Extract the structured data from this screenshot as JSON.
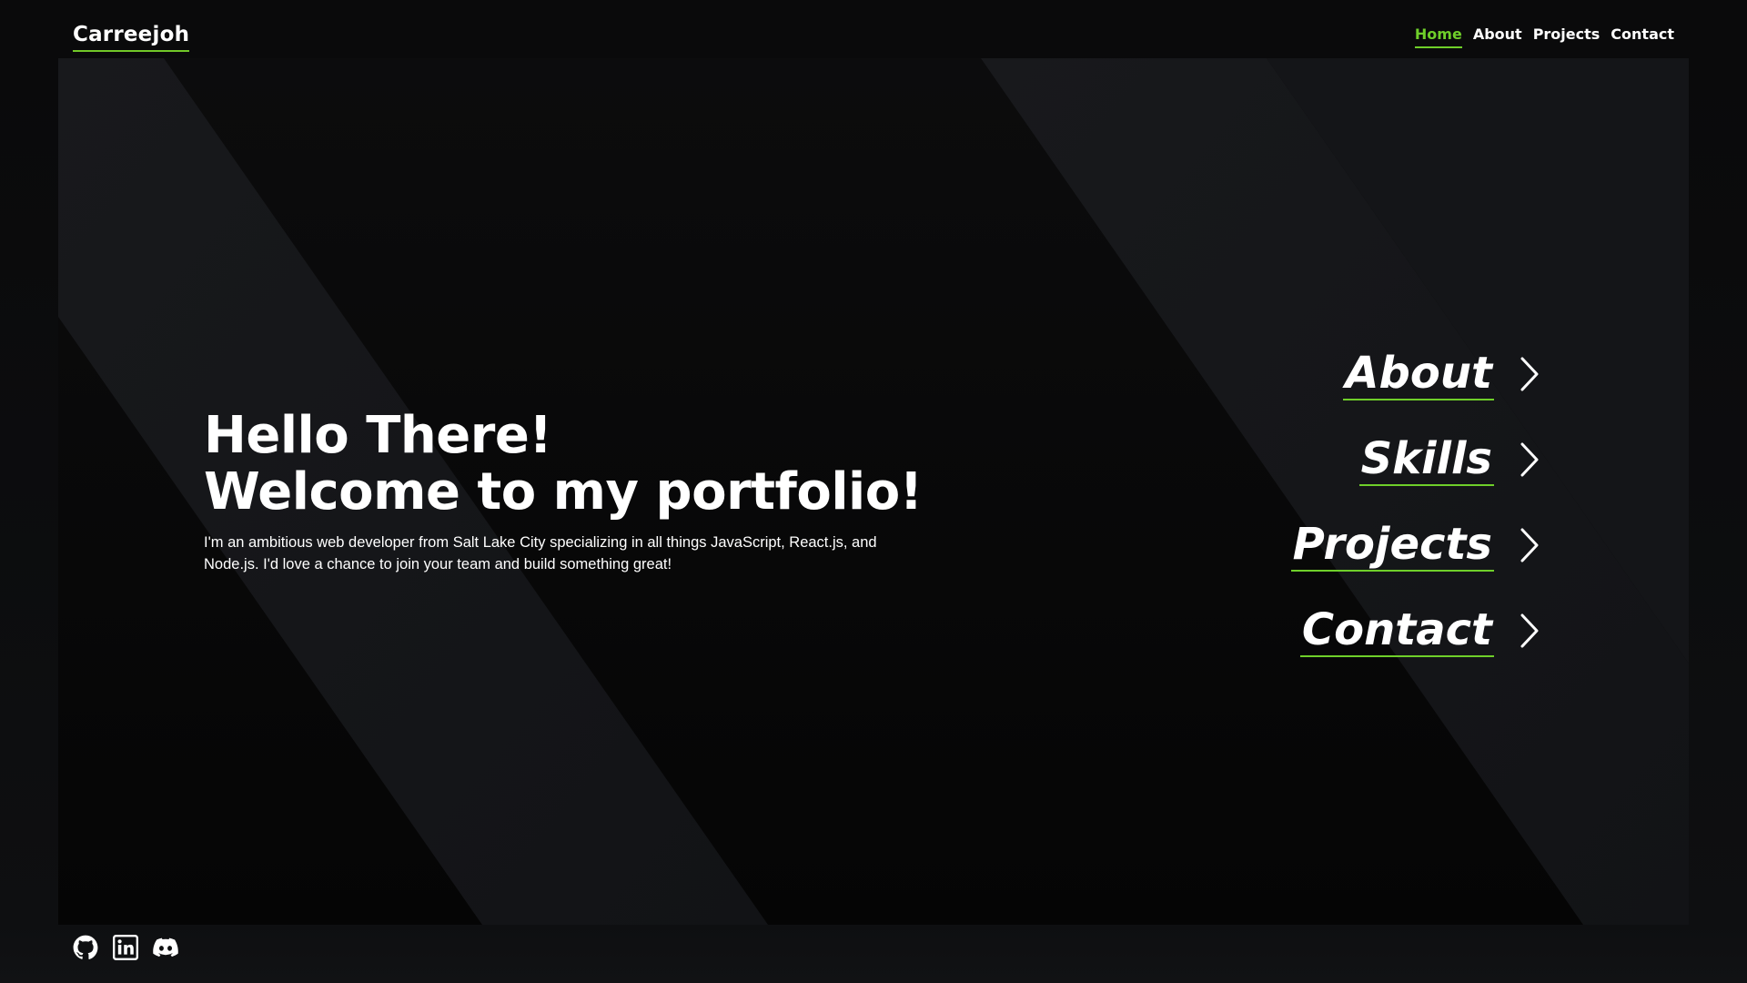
{
  "brand": {
    "name": "Carreejoh"
  },
  "nav": {
    "items": [
      {
        "label": "Home",
        "active": true
      },
      {
        "label": "About",
        "active": false
      },
      {
        "label": "Projects",
        "active": false
      },
      {
        "label": "Contact",
        "active": false
      }
    ]
  },
  "hero": {
    "title_line1": "Hello There!",
    "title_line2": "Welcome to my portfolio!",
    "description": "I'm an ambitious web developer from Salt Lake City specializing in all things JavaScript, React.js, and Node.js. I'd love a chance to join your team and build something great!"
  },
  "cta": {
    "items": [
      {
        "label": "About",
        "icon": "chevron-right-icon"
      },
      {
        "label": "Skills",
        "icon": "chevron-right-icon"
      },
      {
        "label": "Projects",
        "icon": "chevron-right-icon"
      },
      {
        "label": "Contact",
        "icon": "chevron-right-icon"
      }
    ]
  },
  "social": {
    "icons": [
      "github-icon",
      "linkedin-icon",
      "discord-icon"
    ]
  },
  "colors": {
    "accent": "#6fcf2a",
    "background": "#0a0a0b",
    "stripe": "#16171a",
    "text": "#ffffff"
  }
}
